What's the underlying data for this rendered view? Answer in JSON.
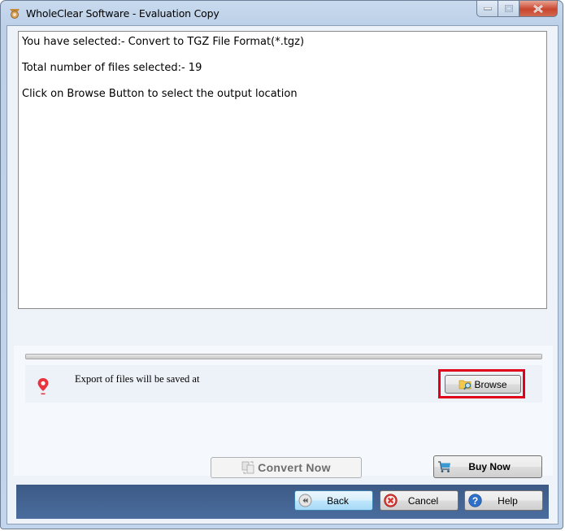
{
  "window": {
    "title": "WholeClear Software - Evaluation Copy",
    "app_icon": "app-logo-icon",
    "controls": {
      "minimize": "minimize-icon",
      "maximize": "maximize-icon",
      "close": "close-icon"
    }
  },
  "info": {
    "lines": [
      "You have selected:- Convert to TGZ File Format(*.tgz)",
      "Total number of files selected:- 19",
      "Click on Browse Button to select the output location"
    ]
  },
  "progress": {
    "value": 0
  },
  "export": {
    "icon": "location-pin-icon",
    "label": "Export of files will be saved at",
    "browse_label": "Browse",
    "browse_icon": "folder-search-icon",
    "highlight_color": "#e0001b"
  },
  "actions": {
    "convert_label": "Convert Now",
    "convert_icon": "convert-icon",
    "convert_enabled": false,
    "buy_label": "Buy Now",
    "buy_icon": "cart-icon"
  },
  "nav": {
    "back_label": "Back",
    "back_icon": "rewind-icon",
    "cancel_label": "Cancel",
    "cancel_icon": "cancel-icon",
    "help_label": "Help",
    "help_icon": "help-icon"
  },
  "colors": {
    "bottom_bar": "#4a6d9e",
    "close_button": "#c9462f",
    "pin": "#e8343c"
  }
}
